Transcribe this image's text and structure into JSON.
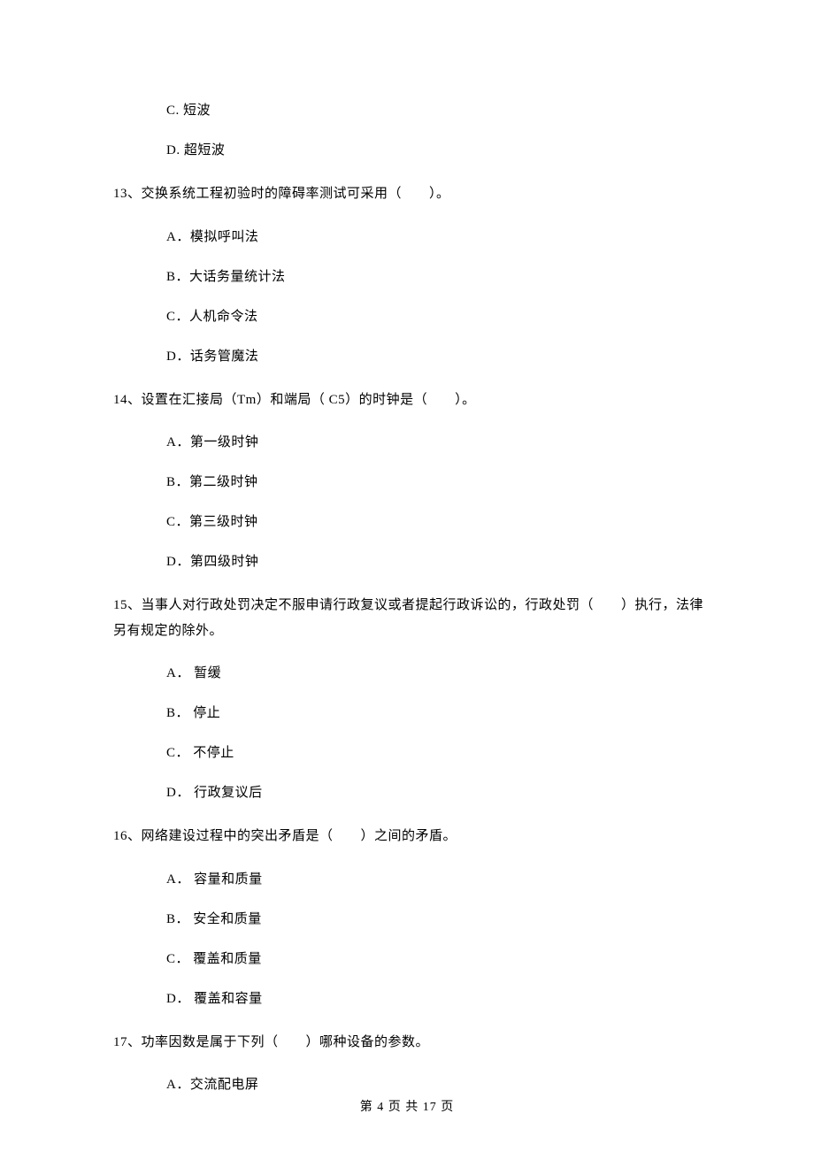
{
  "orphan_options": [
    "C. 短波",
    "D. 超短波"
  ],
  "questions": [
    {
      "stem": "13、交换系统工程初验时的障碍率测试可采用（　　）。",
      "options": [
        "A．模拟呼叫法",
        "B．大话务量统计法",
        "C．人机命令法",
        "D．话务管魔法"
      ]
    },
    {
      "stem": "14、设置在汇接局（Tm）和端局（ C5）的时钟是（　　）。",
      "options": [
        "A．第一级时钟",
        "B．第二级时钟",
        "C．第三级时钟",
        "D．第四级时钟"
      ]
    },
    {
      "stem": "15、当事人对行政处罚决定不服申请行政复议或者提起行政诉讼的，行政处罚（　　）执行，法律另有规定的除外。",
      "options": [
        "A． 暂缓",
        "B． 停止",
        "C． 不停止",
        "D． 行政复议后"
      ]
    },
    {
      "stem": "16、网络建设过程中的突出矛盾是（　　）之间的矛盾。",
      "options": [
        "A． 容量和质量",
        "B． 安全和质量",
        "C． 覆盖和质量",
        "D． 覆盖和容量"
      ]
    },
    {
      "stem": "17、功率因数是属于下列（　　）哪种设备的参数。",
      "options": [
        "A．交流配电屏"
      ]
    }
  ],
  "footer": "第 4 页 共 17 页"
}
